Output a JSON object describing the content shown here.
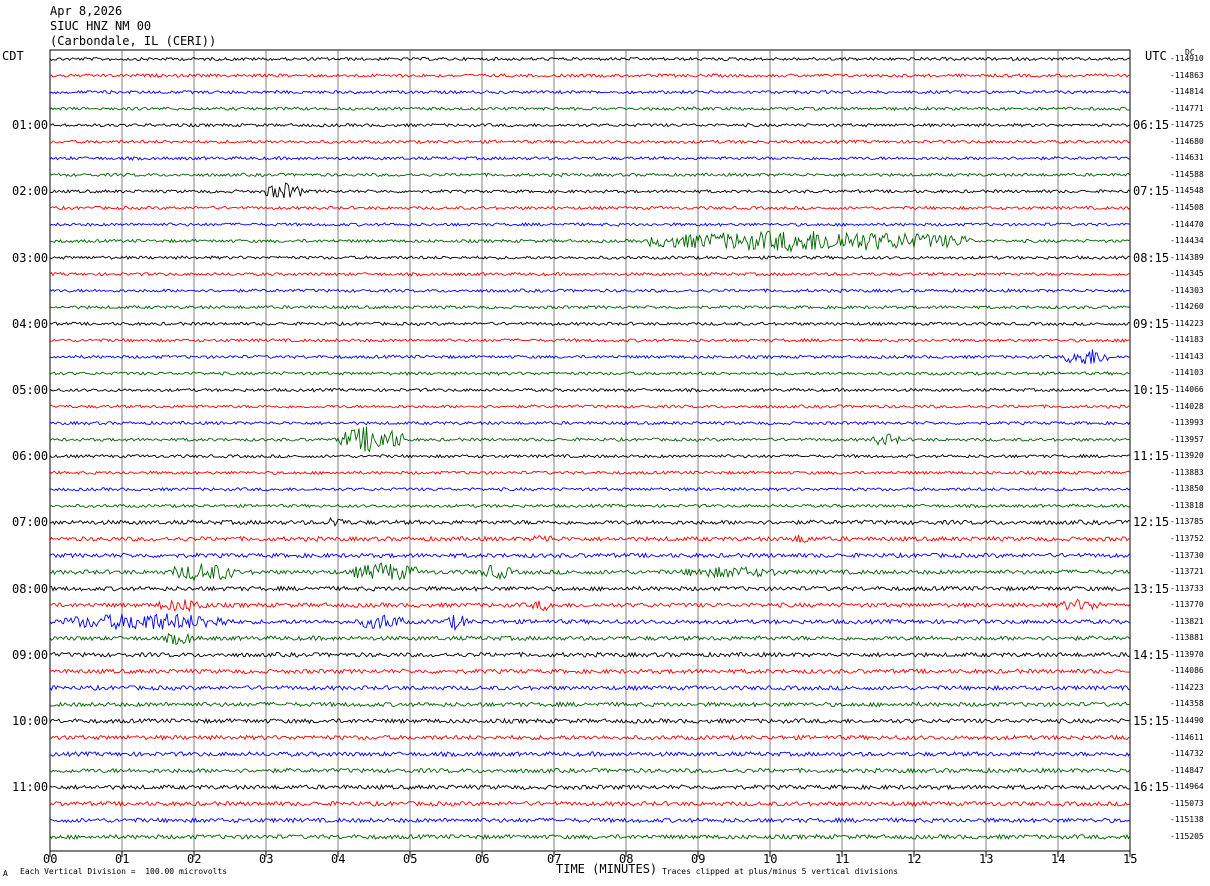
{
  "header": {
    "date": "Apr 8,2026",
    "station": "SIUC HNZ NM 00",
    "location": "(Carbondale, IL (CERI))"
  },
  "left_zone_label": "CDT",
  "right_zone_label": "UTC",
  "dc_label": "DC",
  "footer": {
    "vertical_division": "Each Vertical Division =  100.00 microvolts",
    "xlabel": "TIME (MINUTES)",
    "clip_note": "Traces clipped at plus/minus 5 vertical divisions",
    "corner_mark": "A"
  },
  "colors": {
    "cycle": [
      "#000000",
      "#ff0000",
      "#0000ff",
      "#006400"
    ],
    "grid": "#808080"
  },
  "chart_data": {
    "type": "line",
    "title": "SIUC HNZ NM 00",
    "xlabel": "TIME (MINUTES)",
    "xlim": [
      0,
      15
    ],
    "x_ticks": [
      "00",
      "01",
      "02",
      "03",
      "04",
      "05",
      "06",
      "07",
      "08",
      "09",
      "10",
      "11",
      "12",
      "13",
      "14",
      "15"
    ],
    "trace_count": 48,
    "cdt_hour_labels": [
      "01:00",
      "02:00",
      "03:00",
      "04:00",
      "05:00",
      "06:00",
      "07:00",
      "08:00",
      "09:00",
      "10:00",
      "11:00"
    ],
    "utc_hour_labels": [
      "06:15",
      "07:15",
      "08:15",
      "09:15",
      "10:15",
      "11:15",
      "12:15",
      "13:15",
      "14:15",
      "15:15",
      "16:15"
    ],
    "dc_offsets": [
      "-114910",
      "-114863",
      "-114814",
      "-114771",
      "-114725",
      "-114680",
      "-114631",
      "-114588",
      "-114548",
      "-114508",
      "-114470",
      "-114434",
      "-114389",
      "-114345",
      "-114303",
      "-114260",
      "-114223",
      "-114183",
      "-114143",
      "-114103",
      "-114066",
      "-114028",
      "-113993",
      "-113957",
      "-113920",
      "-113883",
      "-113850",
      "-113818",
      "-113785",
      "-113752",
      "-113730",
      "-113721",
      "-113733",
      "-113770",
      "-113821",
      "-113881",
      "-113970",
      "-114086",
      "-114223",
      "-114358",
      "-114490",
      "-114611",
      "-114732",
      "-114847",
      "-114964",
      "-115073",
      "-115138",
      "-115205"
    ],
    "events": [
      {
        "trace": 8,
        "start_min": 3.0,
        "end_min": 3.5,
        "amplitude": 1.6
      },
      {
        "trace": 11,
        "start_min": 8.3,
        "end_min": 12.8,
        "amplitude": 2.0
      },
      {
        "trace": 18,
        "start_min": 14.1,
        "end_min": 14.7,
        "amplitude": 1.7
      },
      {
        "trace": 23,
        "start_min": 4.0,
        "end_min": 4.9,
        "amplitude": 2.6
      },
      {
        "trace": 23,
        "start_min": 11.4,
        "end_min": 11.8,
        "amplitude": 1.0
      },
      {
        "trace": 28,
        "start_min": 3.85,
        "end_min": 4.1,
        "amplitude": 1.0
      },
      {
        "trace": 29,
        "start_min": 6.7,
        "end_min": 7.0,
        "amplitude": 0.6
      },
      {
        "trace": 29,
        "start_min": 10.3,
        "end_min": 10.6,
        "amplitude": 0.6
      },
      {
        "trace": 31,
        "start_min": 1.7,
        "end_min": 2.6,
        "amplitude": 1.6
      },
      {
        "trace": 31,
        "start_min": 4.2,
        "end_min": 5.1,
        "amplitude": 1.6
      },
      {
        "trace": 31,
        "start_min": 6.0,
        "end_min": 6.4,
        "amplitude": 1.2
      },
      {
        "trace": 31,
        "start_min": 8.8,
        "end_min": 10.1,
        "amplitude": 0.8
      },
      {
        "trace": 33,
        "start_min": 1.5,
        "end_min": 2.2,
        "amplitude": 1.0
      },
      {
        "trace": 33,
        "start_min": 6.7,
        "end_min": 7.0,
        "amplitude": 0.8
      },
      {
        "trace": 33,
        "start_min": 14.0,
        "end_min": 14.6,
        "amplitude": 0.8
      },
      {
        "trace": 34,
        "start_min": 0.2,
        "end_min": 2.5,
        "amplitude": 1.5
      },
      {
        "trace": 34,
        "start_min": 4.3,
        "end_min": 4.9,
        "amplitude": 1.3
      },
      {
        "trace": 34,
        "start_min": 5.5,
        "end_min": 5.8,
        "amplitude": 1.3
      },
      {
        "trace": 35,
        "start_min": 1.6,
        "end_min": 2.0,
        "amplitude": 1.0
      }
    ]
  }
}
